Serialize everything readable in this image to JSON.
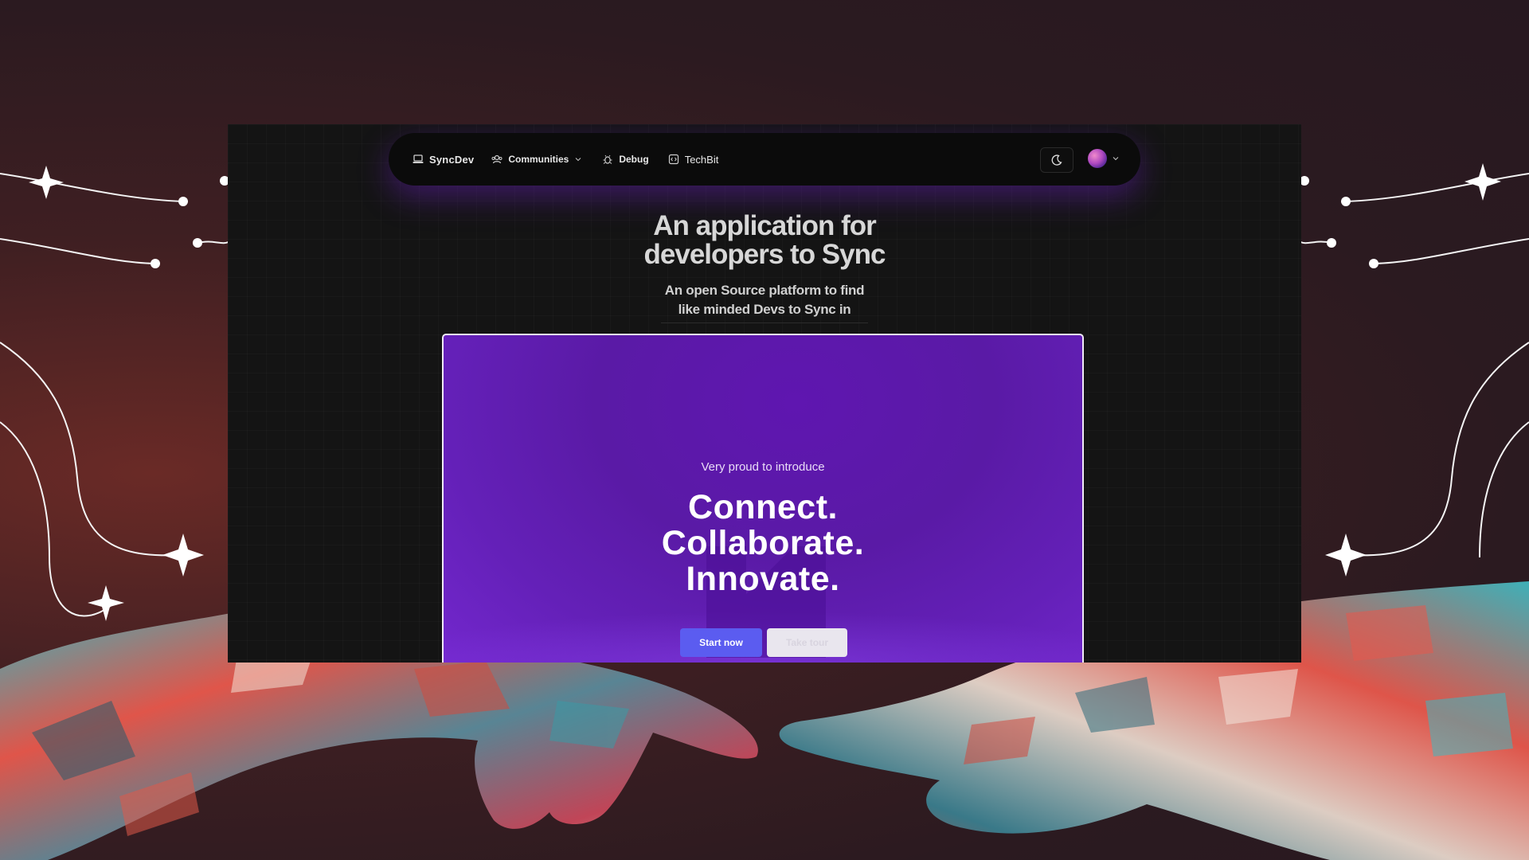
{
  "navbar": {
    "brand": "SyncDev",
    "communities": "Communities",
    "debug": "Debug",
    "techbit": "TechBit",
    "icons": [
      "laptop-icon",
      "users-icon",
      "bug-icon",
      "code-icon",
      "moon-icon",
      "chevron-down-icon"
    ]
  },
  "hero": {
    "title_line1": "An application for",
    "title_line2": "developers to Sync",
    "sub_line1": "An open Source platform to find",
    "sub_line2": "like minded Devs to Sync in"
  },
  "showcase": {
    "intro": "Very proud to introduce",
    "line1": "Connect.",
    "line2": "Collaborate.",
    "line3": "Innovate.",
    "start_button": "Start now",
    "tour_button": "Take tour"
  },
  "colors": {
    "background": "#2b1a20",
    "window": "#141414",
    "showcase": "#5f16b0",
    "primary_button": "#5b5cf0"
  }
}
